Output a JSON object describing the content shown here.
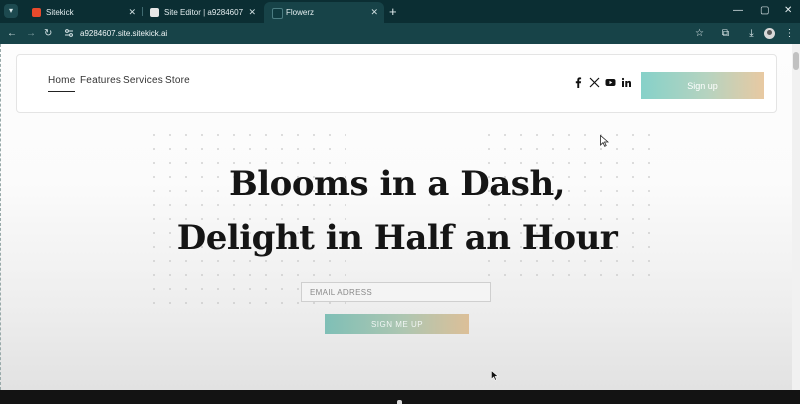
{
  "browser": {
    "tabs": [
      {
        "label": "Sitekick",
        "active": false
      },
      {
        "label": "Site Editor | a9284607",
        "active": false
      },
      {
        "label": "Flowerz",
        "active": true
      }
    ],
    "new_tab_label": "+",
    "url": "a9284607.site.sitekick.ai",
    "colors": {
      "frame": "#0b2e33",
      "toolbar": "#174348"
    }
  },
  "site": {
    "nav": {
      "items": [
        {
          "label": "Home",
          "active": true
        },
        {
          "label": "Features",
          "active": false
        },
        {
          "label": "Services",
          "active": false
        },
        {
          "label": "Store",
          "active": false
        }
      ]
    },
    "social_icons": [
      "facebook-icon",
      "x-icon",
      "youtube-icon",
      "linkedin-icon"
    ],
    "signup_label": "Sign up",
    "hero": {
      "title_line1": "Blooms in a Dash,",
      "title_line2": "Delight in Half an Hour",
      "email_placeholder": "EMAIL ADRESS",
      "cta_label": "SIGN ME UP"
    },
    "colors": {
      "accent_start": "#86d1c9",
      "accent_end": "#e8c9a2"
    }
  }
}
